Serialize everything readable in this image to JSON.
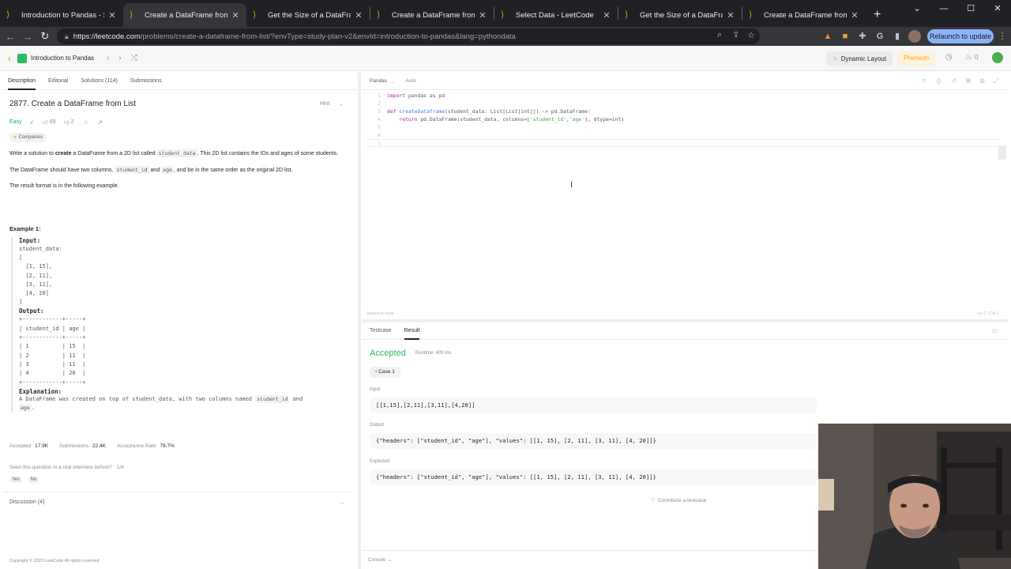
{
  "browser": {
    "tabs": [
      {
        "title": "Introduction to Pandas - Stud",
        "active": false
      },
      {
        "title": "Create a DataFrame from List",
        "active": true
      },
      {
        "title": "Get the Size of a DataFrame",
        "active": false
      },
      {
        "title": "Create a DataFrame from List",
        "active": false
      },
      {
        "title": "Select Data - LeetCode",
        "active": false
      },
      {
        "title": "Get the Size of a DataFrame",
        "active": false
      },
      {
        "title": "Create a DataFrame from List",
        "active": false
      }
    ],
    "url_domain": "https://leetcode.com",
    "url_path": "/problems/create-a-dataframe-from-list/?envType=study-plan-v2&envId=introduction-to-pandas&lang=pythondata",
    "relaunch_label": "Relaunch to update"
  },
  "lc_nav": {
    "study_plan": "Introduction to Pandas",
    "dynamic_layout": "Dynamic Layout",
    "premium": "Premium",
    "streak": "0"
  },
  "problem": {
    "tabs": [
      "Description",
      "Editorial",
      "Solutions (114)",
      "Submissions"
    ],
    "title": "2877. Create a DataFrame from List",
    "hint": "Hint",
    "difficulty": "Easy",
    "likes": "69",
    "dislikes": "2",
    "companies": "Companies",
    "desc1_a": "Write a solution to ",
    "desc1_b": "create",
    "desc1_c": " a DataFrame from a 2D list called ",
    "desc1_code": "student_data",
    "desc1_d": ". This 2D list contains the IDs and ages of some students.",
    "desc2_a": "The DataFrame should have two columns, ",
    "desc2_code1": "student_id",
    "desc2_b": " and ",
    "desc2_code2": "age",
    "desc2_c": ", and be in the same order as the original 2D list.",
    "desc3": "The result format is in the following example.",
    "example_title": "Example 1:",
    "input_label": "Input:",
    "input_code": "student_data:\n[\n  [1, 15],\n  [2, 11],\n  [3, 11],\n  [4, 20]\n]",
    "output_label": "Output:",
    "output_code": "+------------+-----+\n| student_id | age |\n+------------+-----+\n| 1          | 15  |\n| 2          | 11  |\n| 3          | 11  |\n| 4          | 20  |\n+------------+-----+",
    "explanation_label": "Explanation:",
    "explanation_a": "A DataFrame was created on top of student_data, with two columns named ",
    "explanation_code": "student_id",
    "explanation_b": " and",
    "explanation_code2": "age",
    "explanation_c": ".",
    "stats": {
      "accepted_label": "Accepted",
      "accepted": "17.9K",
      "submissions_label": "Submissions",
      "submissions": "22.4K",
      "rate_label": "Acceptance Rate",
      "rate": "79.7%"
    },
    "interview_q": "Seen this question in a real interview before?",
    "interview_page": "1/4",
    "yes": "Yes",
    "no": "No",
    "discussion": "Discussion (4)",
    "copyright": "Copyright © 2023 LeetCode All rights reserved"
  },
  "editor": {
    "language": "Pandas",
    "auto": "Auto",
    "lines": [
      {
        "n": "1",
        "text": "import pandas as pd"
      },
      {
        "n": "2",
        "text": ""
      },
      {
        "n": "3",
        "text": "def createDataframe(student_data: List[List[int]]) -> pd.DataFrame:"
      },
      {
        "n": "4",
        "text": "    return pd.DataFrame(student_data, columns=['student_id','age'], dtype=int)"
      },
      {
        "n": "5",
        "text": ""
      },
      {
        "n": "6",
        "text": ""
      },
      {
        "n": "7",
        "text": ""
      }
    ],
    "saved": "Saved to local",
    "cursor_pos": "Ln 7, Col 1"
  },
  "result": {
    "tabs": [
      "Testcase",
      "Result"
    ],
    "status": "Accepted",
    "runtime": "Runtime: 409 ms",
    "case": "Case 1",
    "input_label": "Input",
    "input_value": "[[1,15],[2,11],[3,11],[4,20]]",
    "output_label": "Output",
    "output_value": "{\"headers\": [\"student_id\", \"age\"], \"values\": [[1, 15], [2, 11], [3, 11], [4, 20]]}",
    "expected_label": "Expected",
    "expected_value": "{\"headers\": [\"student_id\", \"age\"], \"values\": [[1, 15], [2, 11], [3, 11], [4, 20]]}",
    "contribute": "Contribute a testcase",
    "console": "Console"
  },
  "colors": {
    "accent_green": "#2cbb5d",
    "easy": "#00b8a3",
    "premium": "#ffa116",
    "chrome_dark": "#202124"
  }
}
